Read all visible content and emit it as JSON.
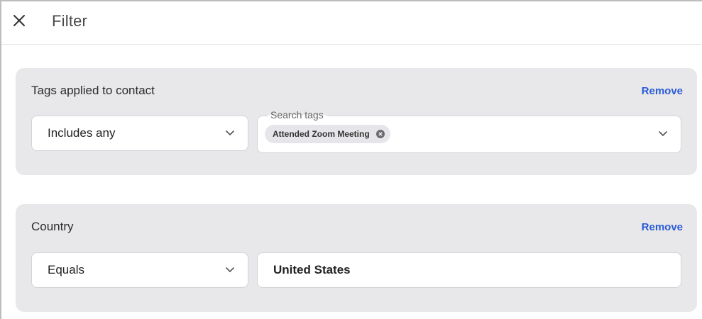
{
  "header": {
    "close_icon": "close-icon",
    "title": "Filter"
  },
  "filters": [
    {
      "title": "Tags applied to contact",
      "remove_label": "Remove",
      "operator": {
        "value": "Includes any",
        "icon": "chevron-down-icon"
      },
      "tags_field": {
        "label": "Search tags",
        "chips": [
          {
            "label": "Attended Zoom Meeting",
            "remove_icon": "remove-chip-icon"
          }
        ],
        "icon": "chevron-down-icon"
      }
    },
    {
      "title": "Country",
      "remove_label": "Remove",
      "operator": {
        "value": "Equals",
        "icon": "chevron-down-icon"
      },
      "value_field": {
        "value": "United States"
      }
    }
  ],
  "colors": {
    "accent": "#2a5bd7",
    "card_bg": "#e8e8ea",
    "border": "#d4d4d8"
  }
}
